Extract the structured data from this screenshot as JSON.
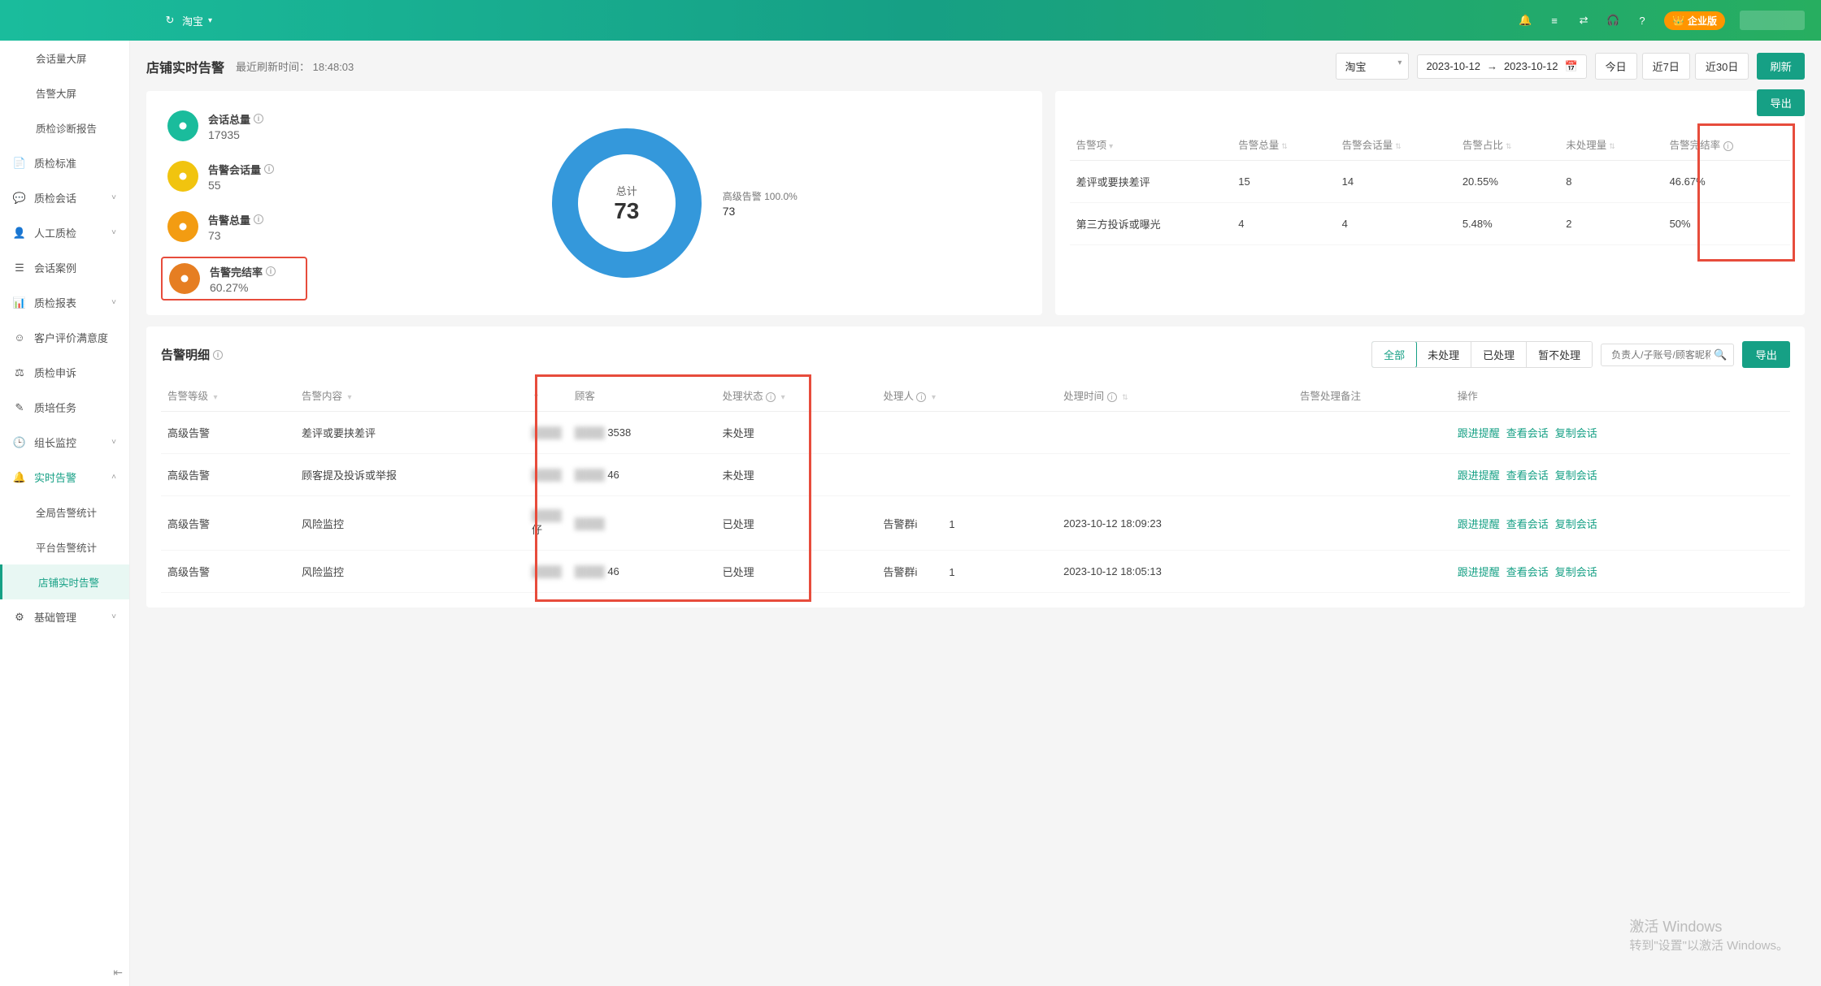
{
  "header": {
    "platform": "淘宝",
    "enterprise_badge": "企业版"
  },
  "sidebar": {
    "items": [
      {
        "label": "会话量大屏",
        "icon": "",
        "kind": "sub"
      },
      {
        "label": "告警大屏",
        "icon": "",
        "kind": "sub"
      },
      {
        "label": "质检诊断报告",
        "icon": "",
        "kind": "sub"
      },
      {
        "label": "质检标准",
        "icon": "doc",
        "chev": false
      },
      {
        "label": "质检会话",
        "icon": "chat",
        "chev": true
      },
      {
        "label": "人工质检",
        "icon": "person",
        "chev": true
      },
      {
        "label": "会话案例",
        "icon": "layers",
        "chev": false
      },
      {
        "label": "质检报表",
        "icon": "report",
        "chev": true
      },
      {
        "label": "客户评价满意度",
        "icon": "smile",
        "chev": false
      },
      {
        "label": "质检申诉",
        "icon": "appeal",
        "chev": false
      },
      {
        "label": "质培任务",
        "icon": "task",
        "chev": false
      },
      {
        "label": "组长监控",
        "icon": "clock",
        "chev": true
      },
      {
        "label": "实时告警",
        "icon": "bell",
        "chev": true,
        "open": true,
        "realtime": true
      },
      {
        "label": "全局告警统计",
        "kind": "sub"
      },
      {
        "label": "平台告警统计",
        "kind": "sub"
      },
      {
        "label": "店铺实时告警",
        "kind": "sub",
        "active": true
      },
      {
        "label": "基础管理",
        "icon": "gear",
        "chev": true
      }
    ]
  },
  "title_bar": {
    "title": "店铺实时告警",
    "refresh_label": "最近刷新时间：",
    "refresh_time": "18:48:03",
    "platform_select": "淘宝",
    "date_from": "2023-10-12",
    "date_to": "2023-10-12",
    "quick": [
      "今日",
      "近7日",
      "近30日"
    ],
    "refresh_btn": "刷新"
  },
  "metrics": [
    {
      "label": "会话总量",
      "value": "17935",
      "color": "green"
    },
    {
      "label": "告警会话量",
      "value": "55",
      "color": "yellow"
    },
    {
      "label": "告警总量",
      "value": "73",
      "color": "orange"
    },
    {
      "label": "告警完结率",
      "value": "60.27%",
      "color": "orange2",
      "highlight": true
    }
  ],
  "donut": {
    "center_label": "总计",
    "center_value": "73",
    "legend_label": "高级告警 100.0%",
    "legend_value": "73"
  },
  "export_btn": "导出",
  "summary_table": {
    "headers": [
      "告警项",
      "告警总量",
      "告警会话量",
      "告警占比",
      "未处理量",
      "告警完结率"
    ],
    "rows": [
      {
        "item": "差评或要挟差评",
        "total": "15",
        "sessions": "14",
        "pct": "20.55%",
        "pending": "8",
        "complete": "46.67%"
      },
      {
        "item": "第三方投诉或曝光",
        "total": "4",
        "sessions": "4",
        "pct": "5.48%",
        "pending": "2",
        "complete": "50%"
      }
    ]
  },
  "detail": {
    "title": "告警明细",
    "tabs": [
      "全部",
      "未处理",
      "已处理",
      "暂不处理"
    ],
    "search_placeholder": "负责人/子账号/顾客昵称",
    "export": "导出",
    "headers": [
      "告警等级",
      "告警内容",
      "",
      "顾客",
      "处理状态",
      "处理人",
      "处理时间",
      "告警处理备注",
      "操作"
    ],
    "rows": [
      {
        "level": "高级告警",
        "content": "差评或要挟差评",
        "c3": "",
        "cust": "3538",
        "status": "未处理",
        "handler": "",
        "time": "",
        "note": ""
      },
      {
        "level": "高级告警",
        "content": "顾客提及投诉或举报",
        "c3": "",
        "cust": "46",
        "status": "未处理",
        "handler": "",
        "time": "",
        "note": ""
      },
      {
        "level": "高级告警",
        "content": "风险监控",
        "c3": "仔",
        "cust": "",
        "status": "已处理",
        "handler": "告警群i　　　1",
        "time": "2023-10-12 18:09:23",
        "note": ""
      },
      {
        "level": "高级告警",
        "content": "风险监控",
        "c3": "",
        "cust": "46",
        "status": "已处理",
        "handler": "告警群i　　　1",
        "time": "2023-10-12 18:05:13",
        "note": ""
      }
    ],
    "actions": [
      "跟进提醒",
      "查看会话",
      "复制会话"
    ]
  },
  "watermark": {
    "l1": "激活 Windows",
    "l2": "转到\"设置\"以激活 Windows。"
  }
}
